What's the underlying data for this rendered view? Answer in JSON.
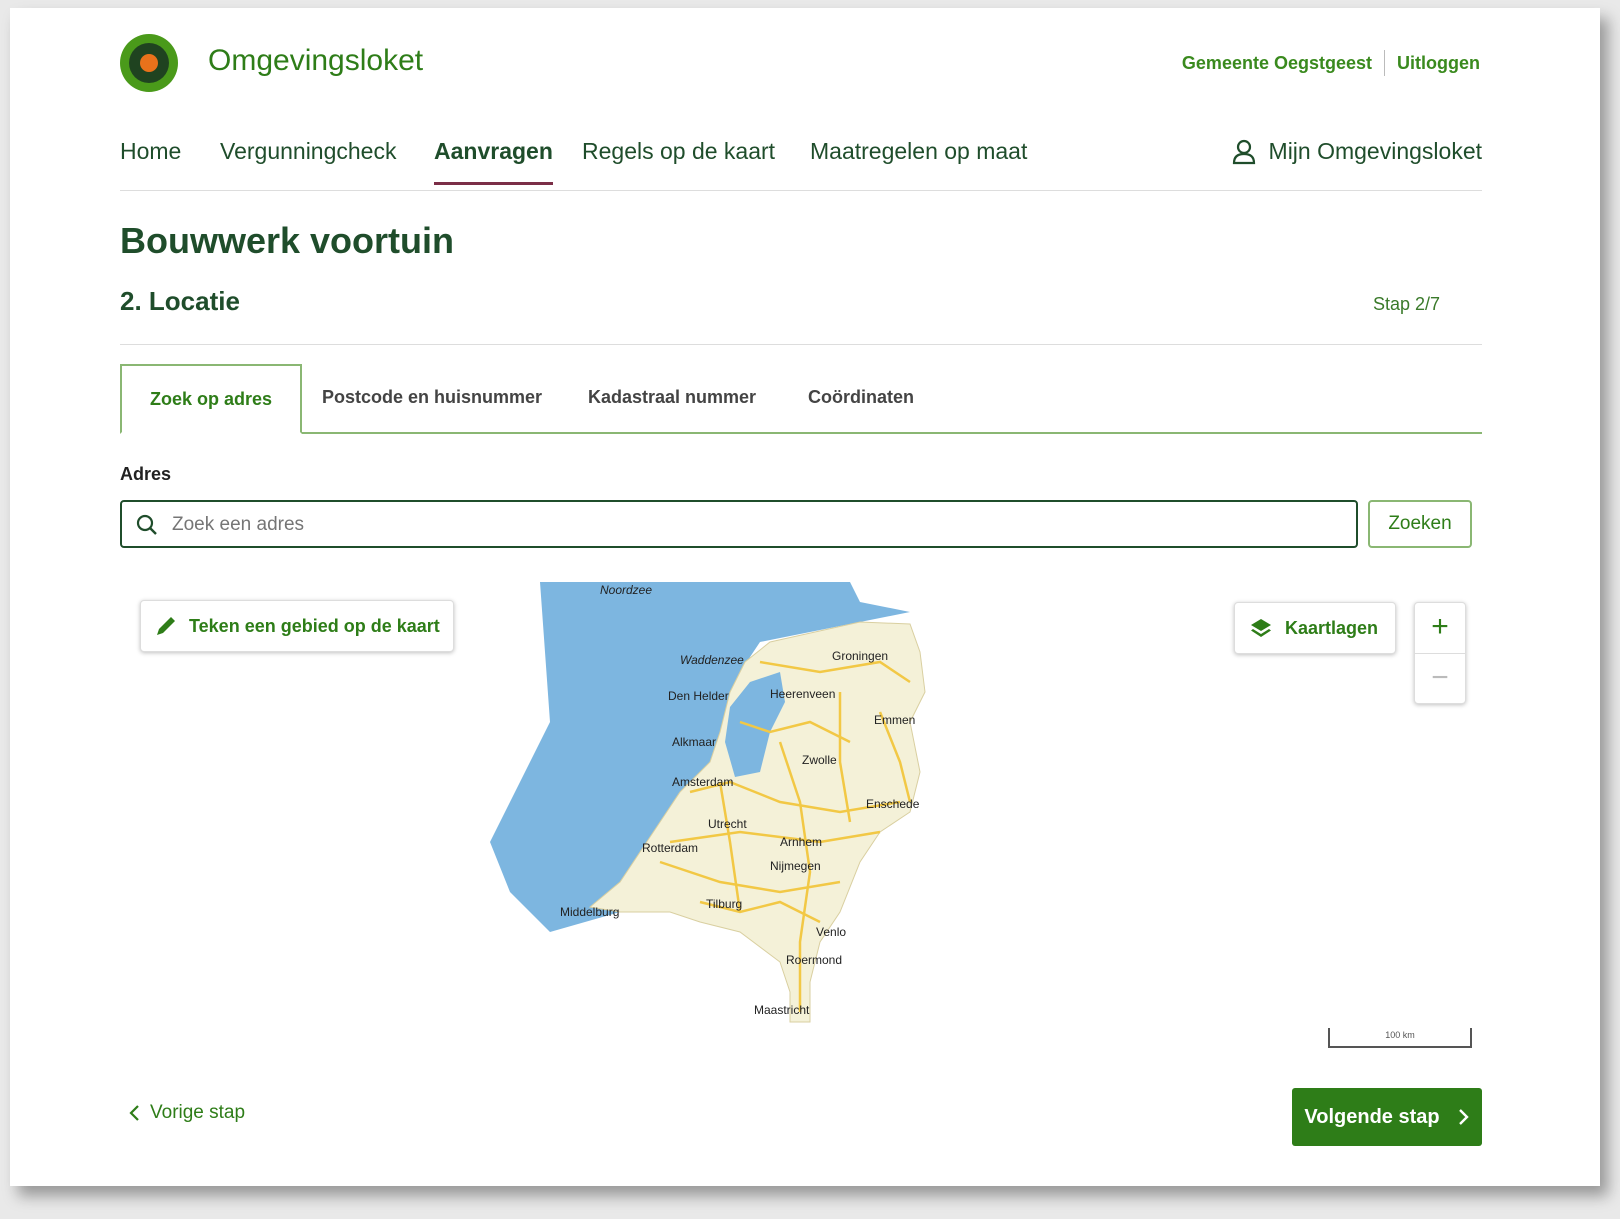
{
  "header": {
    "brand": "Omgevingsloket",
    "municipality": "Gemeente Oegstgeest",
    "logout": "Uitloggen"
  },
  "nav": {
    "items": [
      {
        "label": "Home"
      },
      {
        "label": "Vergunningcheck"
      },
      {
        "label": "Aanvragen",
        "active": true
      },
      {
        "label": "Regels op de kaart"
      },
      {
        "label": "Maatregelen op maat"
      }
    ],
    "account": "Mijn Omgevingsloket"
  },
  "page": {
    "title": "Bouwwerk voortuin",
    "section": "2. Locatie",
    "step": "Stap 2/7"
  },
  "tabs": [
    {
      "label": "Zoek op adres",
      "active": true
    },
    {
      "label": "Postcode en huisnummer"
    },
    {
      "label": "Kadastraal nummer"
    },
    {
      "label": "Coördinaten"
    }
  ],
  "address": {
    "label": "Adres",
    "placeholder": "Zoek een adres",
    "search_button": "Zoeken"
  },
  "map": {
    "draw_button": "Teken een gebied op de kaart",
    "layers_button": "Kaartlagen",
    "zoom_in": "+",
    "zoom_out": "−",
    "scale": "100 km",
    "water_labels": [
      "Noordzee",
      "Waddenzee"
    ],
    "cities": [
      "Groningen",
      "Den Helder",
      "Heerenveen",
      "Emmen",
      "Alkmaar",
      "Zwolle",
      "Amsterdam",
      "Enschede",
      "Utrecht",
      "Rotterdam",
      "Arnhem",
      "Nijmegen",
      "Tilburg",
      "Middelburg",
      "Venlo",
      "Roermond",
      "Maastricht"
    ],
    "colors": {
      "water": "#7db6e0",
      "land": "#f4f1d8",
      "roads": "#f2c845"
    }
  },
  "footer": {
    "prev": "Vorige stap",
    "next": "Volgende stap"
  }
}
